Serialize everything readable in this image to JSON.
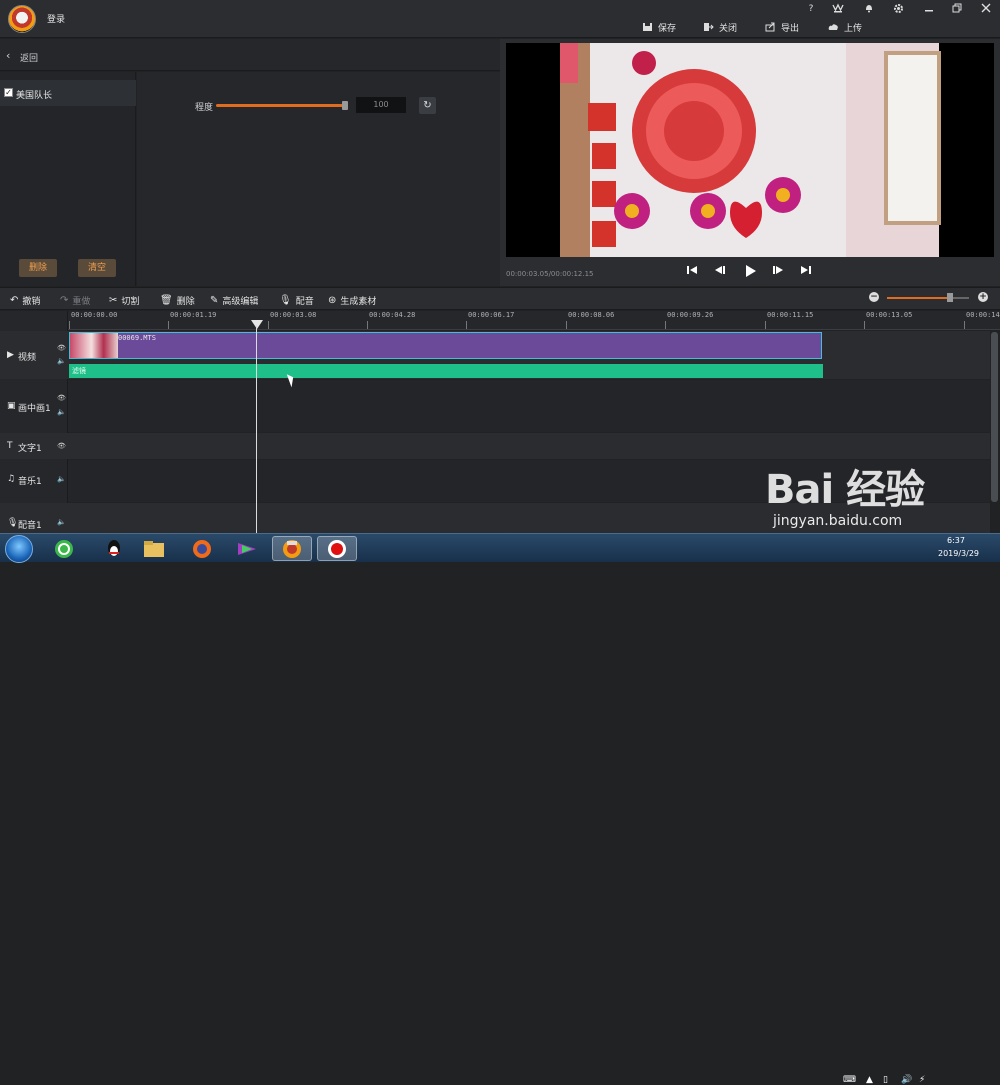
{
  "titlebar": {
    "login": "登录",
    "help": "?",
    "actions": {
      "save": "保存",
      "close": "关闭",
      "export": "导出",
      "upload": "上传"
    }
  },
  "left_panel": {
    "back": "返回",
    "filter_item": "美国队长",
    "delete": "删除",
    "clear": "清空",
    "degree_label": "程度",
    "degree_value": "100",
    "degree_level": 1.0
  },
  "preview": {
    "time": "00:00:03.05/00:00:12.15"
  },
  "toolbar": {
    "undo": "撤销",
    "redo": "重做",
    "cut": "切割",
    "delete": "删除",
    "advanced_edit": "高级编辑",
    "dub": "配音",
    "generate": "生成素材",
    "zoom_level": 0.8
  },
  "ruler": {
    "ticks": [
      "00:00:00.00",
      "00:00:01.19",
      "00:00:03.08",
      "00:00:04.28",
      "00:00:06.17",
      "00:00:08.06",
      "00:00:09.26",
      "00:00:11.15",
      "00:00:13.05",
      "00:00:14."
    ]
  },
  "tracks": {
    "video": "视频",
    "pip": "画中画1",
    "text": "文字1",
    "music": "音乐1",
    "dub": "配音1"
  },
  "clips": {
    "video_name": "00069.MTS",
    "filter_name": "滤镜"
  },
  "taskbar": {
    "time": "6:37",
    "date": "2019/3/29"
  },
  "watermark": {
    "main": "Bai 经验",
    "sub": "jingyan.baidu.com"
  }
}
